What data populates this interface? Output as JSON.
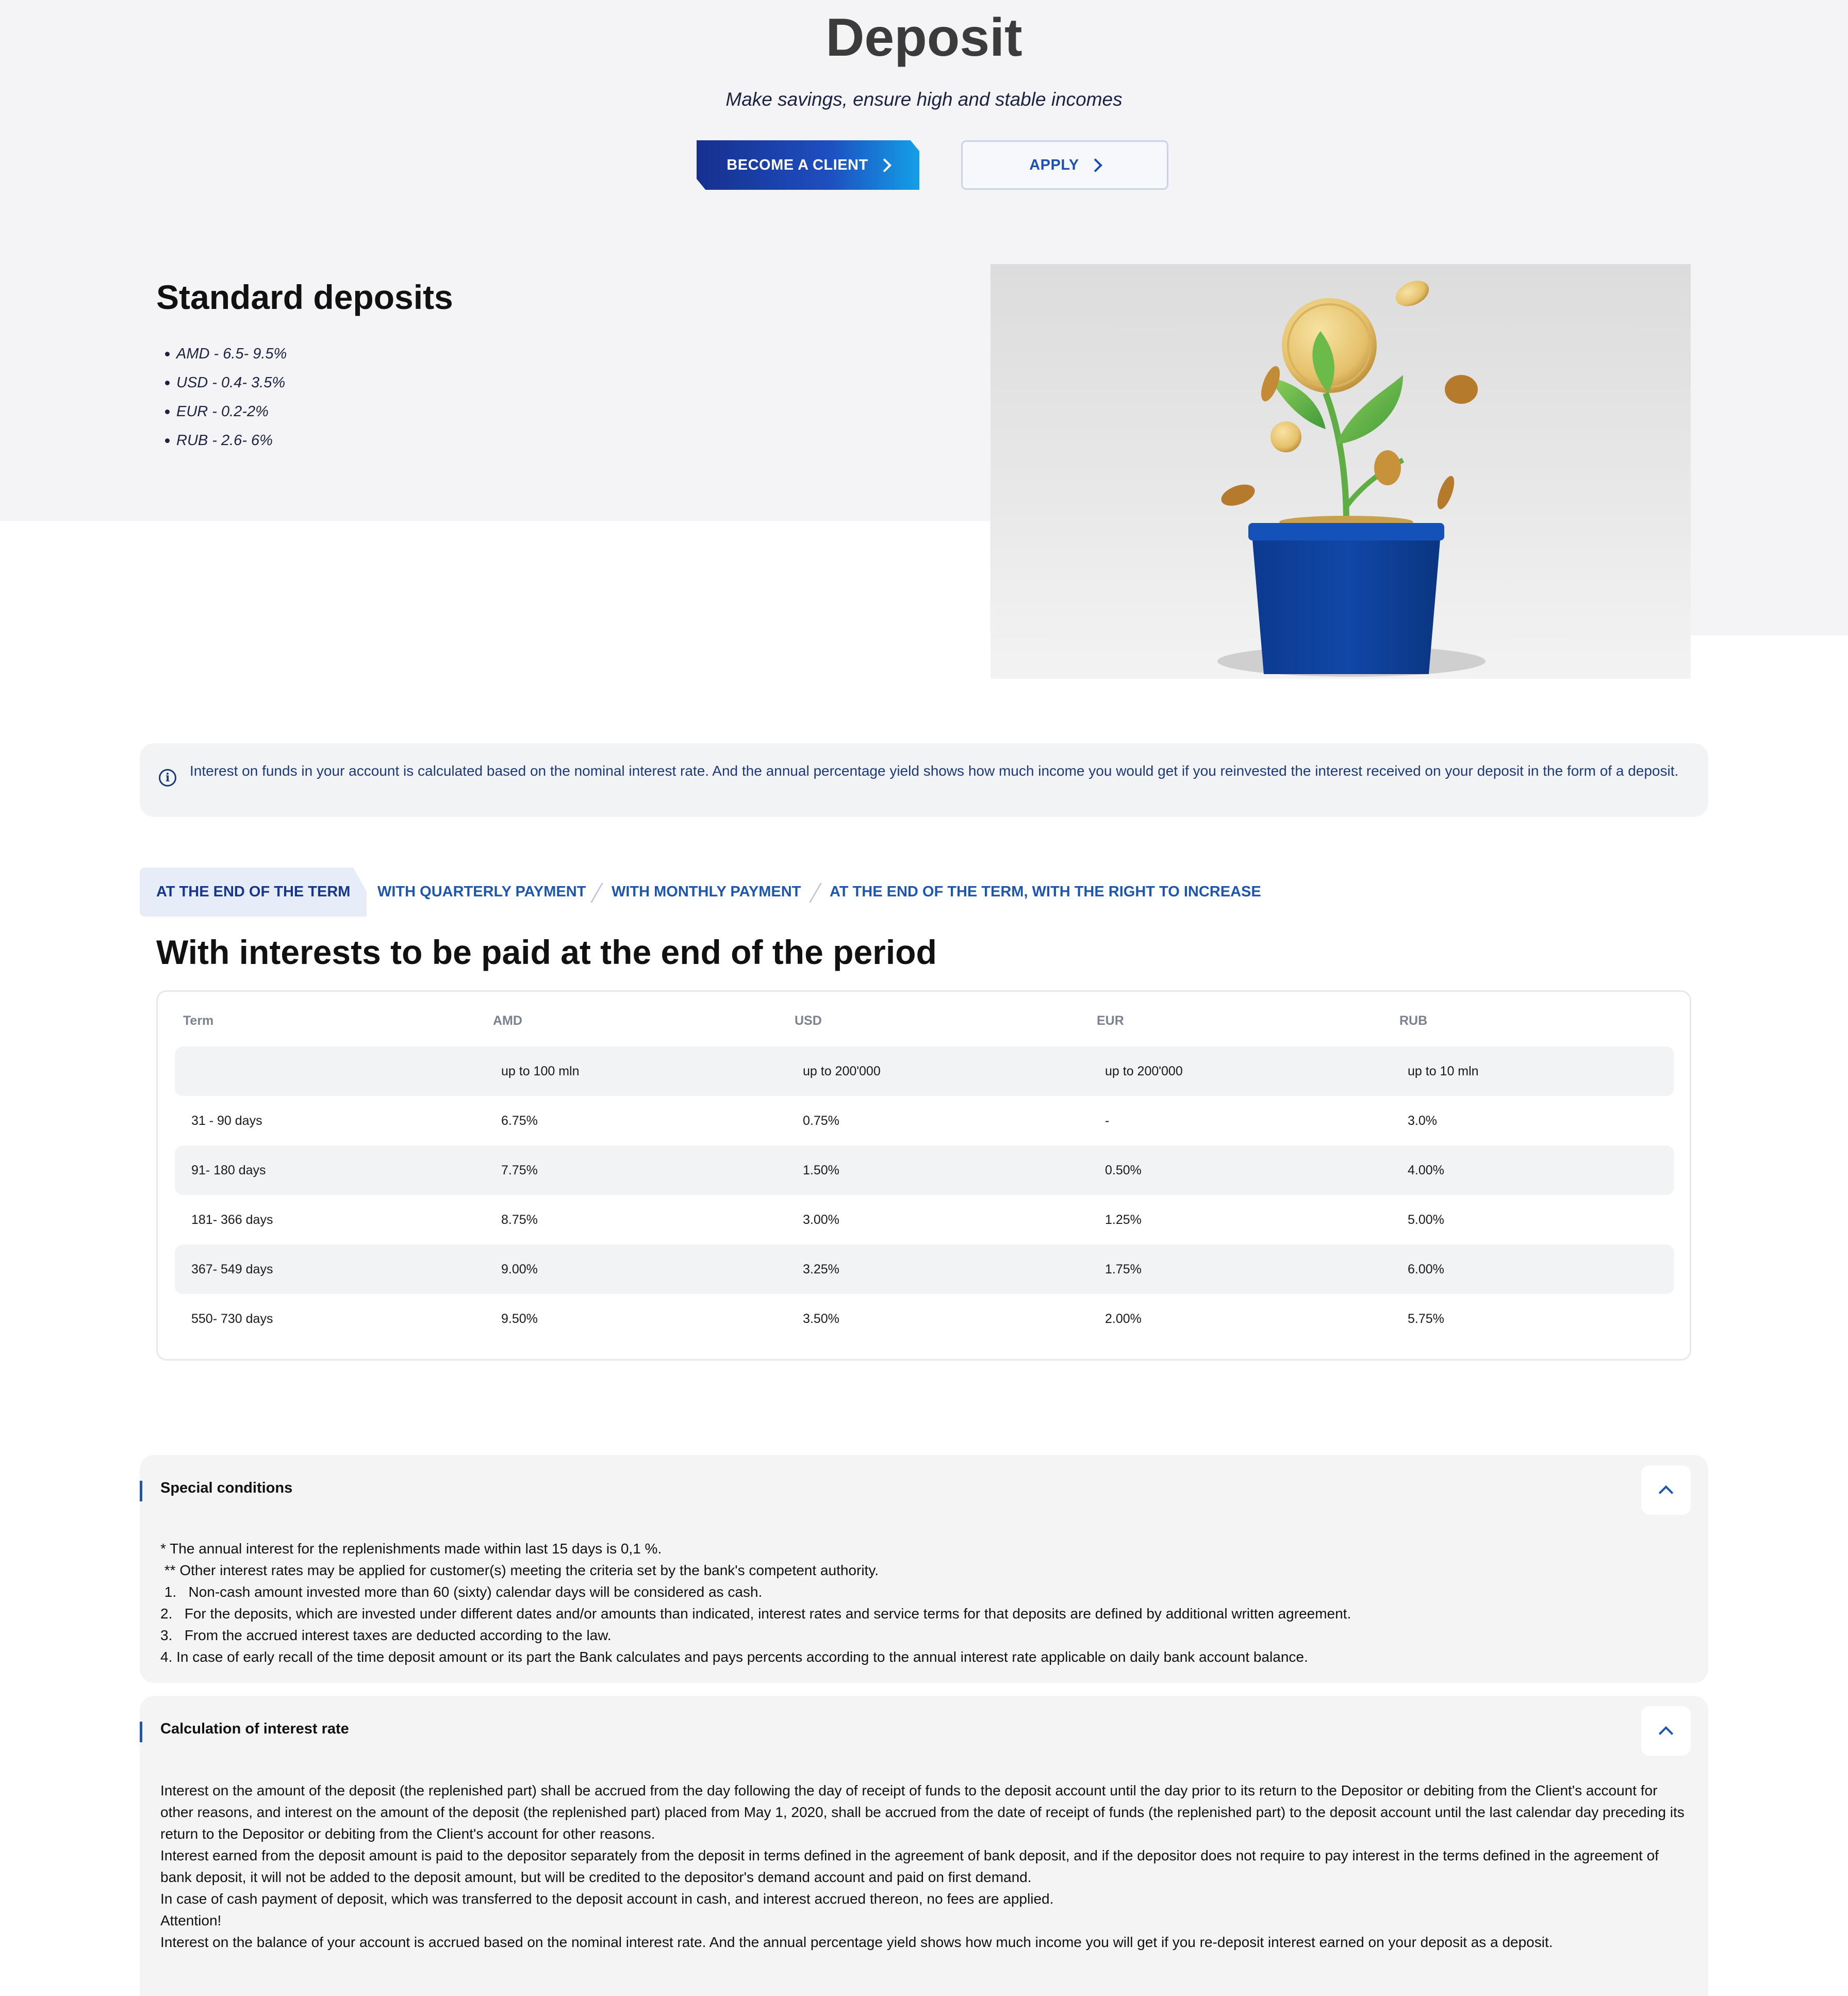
{
  "hero": {
    "title": "Deposit",
    "subtitle": "Make savings, ensure high and stable incomes",
    "become_client_label": "BECOME A CLIENT",
    "apply_label": "APPLY"
  },
  "standard_deposits": {
    "title": "Standard deposits",
    "rates": [
      "AMD - 6.5- 9.5%",
      "USD - 0.4- 3.5%",
      "EUR - 0.2-2%",
      "RUB - 2.6- 6%"
    ]
  },
  "info_note": {
    "icon": "info-icon",
    "text": "Interest on funds in your account is calculated based on the nominal interest rate. And the annual percentage yield shows how much income you would get if you reinvested the interest received on your deposit in the form of a deposit."
  },
  "tabs": [
    {
      "label": "AT THE END OF THE TERM",
      "active": true
    },
    {
      "label": "WITH QUARTERLY PAYMENT",
      "active": false
    },
    {
      "label": "WITH MONTHLY PAYMENT",
      "active": false
    },
    {
      "label": "AT THE END OF THE TERM, WITH THE RIGHT TO INCREASE",
      "active": false
    }
  ],
  "rates_section": {
    "title": "With interests to be paid at the end of the period",
    "headers": [
      "Term",
      "AMD",
      "USD",
      "EUR",
      "RUB"
    ],
    "rows": [
      [
        "",
        "up to 100 mln",
        "up to 200'000",
        "up to 200'000",
        "up to 10 mln"
      ],
      [
        "31 - 90 days",
        "6.75%",
        "0.75%",
        "-",
        "3.0%"
      ],
      [
        "91- 180 days",
        "7.75%",
        "1.50%",
        "0.50%",
        "4.00%"
      ],
      [
        "181- 366 days",
        "8.75%",
        "3.00%",
        "1.25%",
        "5.00%"
      ],
      [
        "367- 549 days",
        "9.00%",
        "3.25%",
        "1.75%",
        "6.00%"
      ],
      [
        "550- 730 days",
        "9.50%",
        "3.50%",
        "2.00%",
        "5.75%"
      ]
    ]
  },
  "special_conditions": {
    "title": "Special conditions",
    "lines": [
      "* The annual interest for the replenishments made within last 15 days is 0,1 %.",
      " ** Other interest rates may be applied for customer(s) meeting the criteria set by the bank's competent authority.",
      " 1.   Non-cash amount invested more than 60 (sixty) calendar days will be considered as cash.",
      "2.   For the deposits, which are invested under different dates and/or amounts than indicated, interest rates and service terms for that deposits are defined by additional written agreement.",
      "3.   From the accrued interest taxes are deducted according to the law.",
      "4. In case of early recall of the time deposit amount or its part the Bank calculates and pays percents according to the annual interest rate applicable on daily bank account balance."
    ]
  },
  "calculation": {
    "title": "Calculation of interest rate",
    "lines": [
      "Interest on the amount of the deposit (the replenished part) shall be accrued from the day following the day of receipt of funds to the deposit account until the day prior to its return to the Depositor or debiting from the Client's account for other reasons, and interest on the amount of the deposit (the replenished part) placed from May 1, 2020, shall be accrued from the date of receipt of funds (the replenished part) to the deposit account until the last calendar day preceding its return to the Depositor or debiting from the Client's account for other reasons.",
      "Interest earned from the deposit amount is paid to the depositor separately from the deposit in terms defined in the agreement of bank deposit, and if the depositor does not require to pay interest in the terms defined in the agreement of bank deposit, it will not be added to the deposit amount, but will be credited to the depositor's demand account and paid on first demand.",
      "In case of cash payment of deposit, which was transferred to the deposit account in cash, and interest accrued thereon, no fees are applied.",
      "Attention!",
      "Interest on the balance of your account is accrued based on the nominal interest rate. And the annual percentage yield shows how much income you will get if you re-deposit interest earned on your deposit as a deposit."
    ]
  }
}
